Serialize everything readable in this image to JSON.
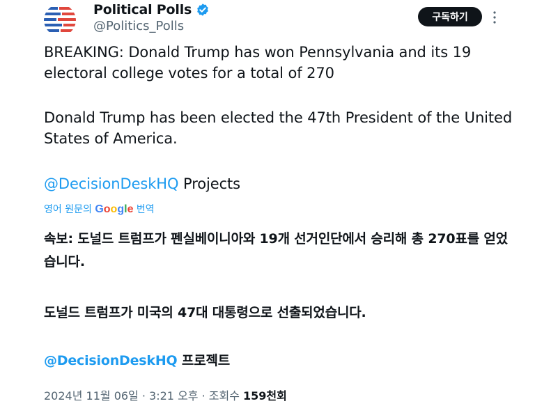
{
  "account": {
    "display_name": "Political Polls",
    "handle": "@Politics_Polls",
    "verified": true
  },
  "actions": {
    "follow_label": "구독하기",
    "more_icon": "more-vertical-icon"
  },
  "tweet": {
    "original_p1": "BREAKING: Donald Trump has won Pennsylvania and its 19 electoral college votes for a total of 270",
    "original_p2": "Donald Trump has been elected the 47th President of the United States of America.",
    "original_mention": "@DecisionDeskHQ",
    "original_p3_rest": " Projects",
    "translate_prefix": "영어 원문의 ",
    "translate_suffix": " 번역",
    "google_logo": "Google",
    "translated_p1": "속보: 도널드 트럼프가 펜실베이니아와 19개 선거인단에서 승리해 총 270표를 얻었습니다.",
    "translated_p2": "도널드 트럼프가 미국의 47대 대통령으로 선출되었습니다.",
    "translated_mention": "@DecisionDeskHQ",
    "translated_p3_rest": " 프로젝트"
  },
  "meta": {
    "date": "2024년 11월 06일",
    "separator": " · ",
    "time": "3:21 오후",
    "views_label": "조회수 ",
    "views_count": "159천회"
  },
  "colors": {
    "accent": "#1d9bf0",
    "text": "#0f1419",
    "muted": "#536471",
    "avatar_red": "#e0473d",
    "avatar_blue": "#2b5fb3"
  }
}
